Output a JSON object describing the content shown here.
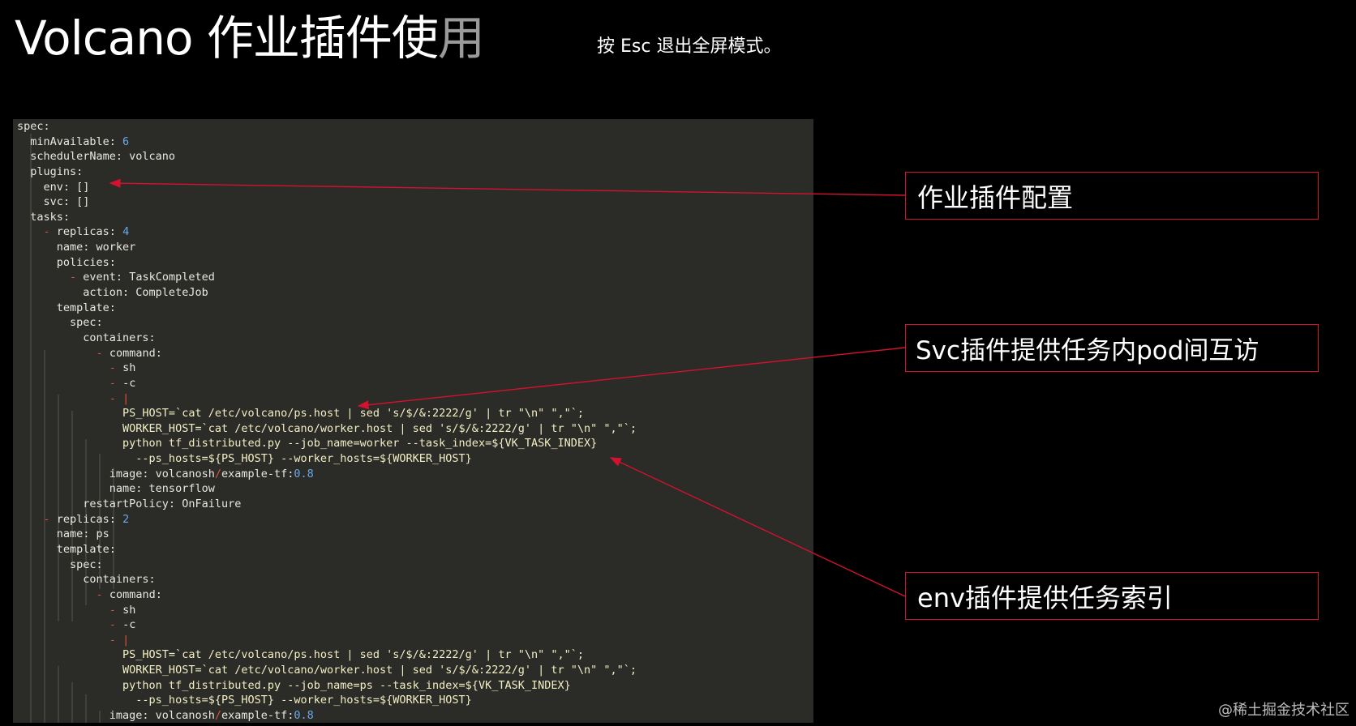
{
  "title": {
    "main": "Volcano 作业插件使",
    "faded": "用"
  },
  "esc_hint": "按 Esc 退出全屏模式。",
  "code_lines": [
    [
      {
        "t": "spec:",
        "c": "w"
      }
    ],
    [
      {
        "t": "  minAvailable: ",
        "c": "w"
      },
      {
        "t": "6",
        "c": "n"
      }
    ],
    [
      {
        "t": "  schedulerName: volcano",
        "c": "w"
      }
    ],
    [
      {
        "t": "  plugins:",
        "c": "w"
      }
    ],
    [
      {
        "t": "    env: []",
        "c": "w"
      }
    ],
    [
      {
        "t": "    svc: []",
        "c": "w"
      }
    ],
    [
      {
        "t": "  tasks:",
        "c": "w"
      }
    ],
    [
      {
        "t": "    ",
        "c": "w"
      },
      {
        "t": "- ",
        "c": "d"
      },
      {
        "t": "replicas: ",
        "c": "w"
      },
      {
        "t": "4",
        "c": "n"
      }
    ],
    [
      {
        "t": "      name: worker",
        "c": "w"
      }
    ],
    [
      {
        "t": "      policies:",
        "c": "w"
      }
    ],
    [
      {
        "t": "        ",
        "c": "w"
      },
      {
        "t": "- ",
        "c": "d"
      },
      {
        "t": "event: TaskCompleted",
        "c": "w"
      }
    ],
    [
      {
        "t": "          action: CompleteJob",
        "c": "w"
      }
    ],
    [
      {
        "t": "      template:",
        "c": "w"
      }
    ],
    [
      {
        "t": "        spec:",
        "c": "w"
      }
    ],
    [
      {
        "t": "          containers:",
        "c": "w"
      }
    ],
    [
      {
        "t": "            ",
        "c": "w"
      },
      {
        "t": "- ",
        "c": "d"
      },
      {
        "t": "command:",
        "c": "w"
      }
    ],
    [
      {
        "t": "              ",
        "c": "w"
      },
      {
        "t": "- ",
        "c": "d"
      },
      {
        "t": "sh",
        "c": "w"
      }
    ],
    [
      {
        "t": "              ",
        "c": "w"
      },
      {
        "t": "- ",
        "c": "d"
      },
      {
        "t": "-c",
        "c": "w"
      }
    ],
    [
      {
        "t": "              ",
        "c": "w"
      },
      {
        "t": "- ",
        "c": "d"
      },
      {
        "t": "|",
        "c": "d"
      }
    ],
    [
      {
        "t": "                PS_HOST=`cat /etc/volcano/ps.host | sed 's/$/&:2222/g' | tr \"\\n\" \",\"`;",
        "c": "s"
      }
    ],
    [
      {
        "t": "                WORKER_HOST=`cat /etc/volcano/worker.host | sed 's/$/&:2222/g' | tr \"\\n\" \",\"`;",
        "c": "s"
      }
    ],
    [
      {
        "t": "                python tf_distributed.py --job_name=worker --task_index=${VK_TASK_INDEX}",
        "c": "s"
      }
    ],
    [
      {
        "t": "                  --ps_hosts=${PS_HOST} --worker_hosts=${WORKER_HOST}",
        "c": "s"
      }
    ],
    [
      {
        "t": "              image: volcanosh",
        "c": "w"
      },
      {
        "t": "/",
        "c": "d"
      },
      {
        "t": "example-tf:",
        "c": "w"
      },
      {
        "t": "0.8",
        "c": "n"
      }
    ],
    [
      {
        "t": "              name: tensorflow",
        "c": "w"
      }
    ],
    [
      {
        "t": "          restartPolicy: OnFailure",
        "c": "w"
      }
    ],
    [
      {
        "t": "    ",
        "c": "w"
      },
      {
        "t": "- ",
        "c": "d"
      },
      {
        "t": "replicas: ",
        "c": "w"
      },
      {
        "t": "2",
        "c": "n"
      }
    ],
    [
      {
        "t": "      name: ps",
        "c": "w"
      }
    ],
    [
      {
        "t": "      template:",
        "c": "w"
      }
    ],
    [
      {
        "t": "        spec:",
        "c": "w"
      }
    ],
    [
      {
        "t": "          containers:",
        "c": "w"
      }
    ],
    [
      {
        "t": "            ",
        "c": "w"
      },
      {
        "t": "- ",
        "c": "d"
      },
      {
        "t": "command:",
        "c": "w"
      }
    ],
    [
      {
        "t": "              ",
        "c": "w"
      },
      {
        "t": "- ",
        "c": "d"
      },
      {
        "t": "sh",
        "c": "w"
      }
    ],
    [
      {
        "t": "              ",
        "c": "w"
      },
      {
        "t": "- ",
        "c": "d"
      },
      {
        "t": "-c",
        "c": "w"
      }
    ],
    [
      {
        "t": "              ",
        "c": "w"
      },
      {
        "t": "- ",
        "c": "d"
      },
      {
        "t": "|",
        "c": "d"
      }
    ],
    [
      {
        "t": "                PS_HOST=`cat /etc/volcano/ps.host | sed 's/$/&:2222/g' | tr \"\\n\" \",\"`;",
        "c": "s"
      }
    ],
    [
      {
        "t": "                WORKER_HOST=`cat /etc/volcano/worker.host | sed 's/$/&:2222/g' | tr \"\\n\" \",\"`;",
        "c": "s"
      }
    ],
    [
      {
        "t": "                python tf_distributed.py --job_name=ps --task_index=${VK_TASK_INDEX}",
        "c": "s"
      }
    ],
    [
      {
        "t": "                  --ps_hosts=${PS_HOST} --worker_hosts=${WORKER_HOST}",
        "c": "s"
      }
    ],
    [
      {
        "t": "              image: volcanosh",
        "c": "w"
      },
      {
        "t": "/",
        "c": "d"
      },
      {
        "t": "example-tf:",
        "c": "w"
      },
      {
        "t": "0.8",
        "c": "n"
      }
    ]
  ],
  "code_colors": {
    "w": "#e8e8e0",
    "n": "#6aa9e8",
    "d": "#e0513c",
    "s": "#f3efc4"
  },
  "callouts": {
    "plugin_config": "作业插件配置",
    "svc_plugin": "Svc插件提供任务内pod间互访",
    "env_plugin": "env插件提供任务索引"
  },
  "accent_color": "#d4112f",
  "watermark": "@稀土掘金技术社区"
}
